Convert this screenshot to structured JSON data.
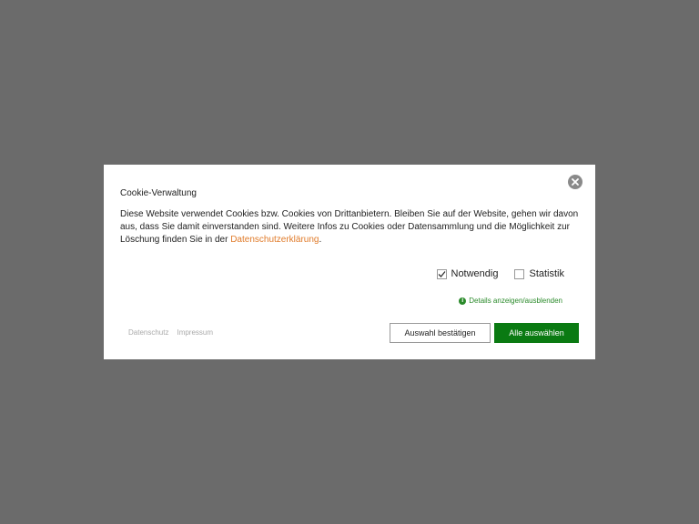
{
  "dialog": {
    "title": "Cookie-Verwaltung",
    "description_before_link": "Diese Website verwendet Cookies bzw. Cookies von Drittanbietern. Bleiben Sie auf der Website, gehen wir davon aus, dass Sie damit einverstanden sind. Weitere Infos zu Cookies oder Datensammlung und die Möglichkeit zur Löschung finden Sie in der ",
    "description_link": "Datenschutzerklärung",
    "description_after_link": ".",
    "close_icon": "close-icon"
  },
  "options": [
    {
      "label": "Notwendig",
      "checked": true
    },
    {
      "label": "Statistik",
      "checked": false
    }
  ],
  "details_link": "Details anzeigen/ausblenden",
  "footer": {
    "privacy_link": "Datenschutz",
    "imprint_link": "Impressum"
  },
  "buttons": {
    "confirm_selection": "Auswahl bestätigen",
    "select_all": "Alle auswählen"
  },
  "colors": {
    "overlay": "#6b6b6b",
    "link_orange": "#e07b2a",
    "accent_green": "#0a7a12"
  }
}
